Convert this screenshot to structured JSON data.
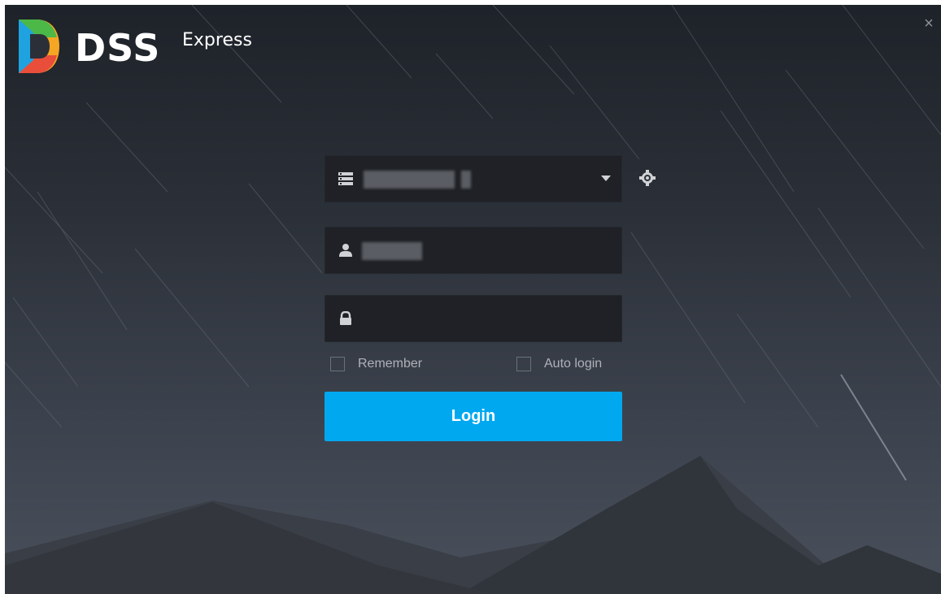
{
  "app": {
    "brand": "DSS",
    "brand_suffix": "Express"
  },
  "window": {
    "close_label": "×"
  },
  "login_form": {
    "server_field": {
      "value": "S                3"
    },
    "username_field": {
      "value": ""
    },
    "password_field": {
      "value": ""
    },
    "remember_label": "Remember",
    "auto_login_label": "Auto login",
    "remember_checked": false,
    "auto_login_checked": false,
    "login_button_label": "Login"
  },
  "icons": [
    "dss-logo-icon",
    "server-list-icon",
    "dropdown-caret-icon",
    "gear-icon",
    "user-icon",
    "lock-icon",
    "close-icon"
  ],
  "colors": {
    "accent": "#00A8F0",
    "field_bg": "#1F2126",
    "background_top": "#1E2229",
    "background_bottom": "#4A505B"
  }
}
